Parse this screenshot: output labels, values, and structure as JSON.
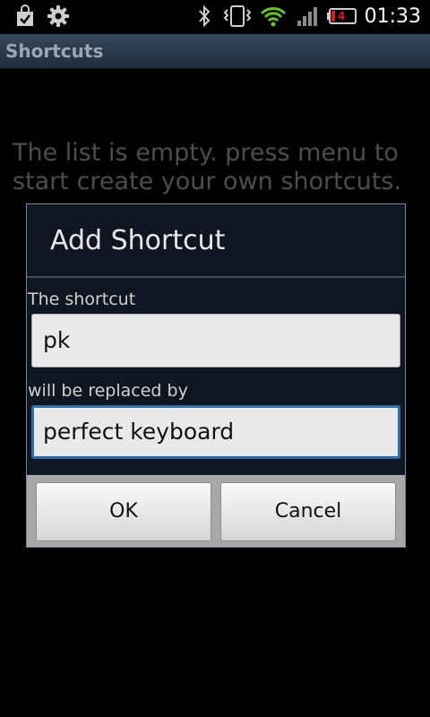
{
  "status_bar": {
    "time": "01:33",
    "battery_level": "4",
    "icons": [
      "bag-icon",
      "gear-icon",
      "bluetooth-icon",
      "vibrate-icon",
      "wifi-icon",
      "signal-icon",
      "battery-icon"
    ]
  },
  "app": {
    "title": "Shortcuts"
  },
  "main": {
    "empty_message": "The list is empty. press menu to start create your own shortcuts."
  },
  "dialog": {
    "title": "Add Shortcut",
    "shortcut_label": "The shortcut",
    "shortcut_value": "pk",
    "replacement_label": "will be replaced by",
    "replacement_value": "perfect keyboard",
    "ok_label": "OK",
    "cancel_label": "Cancel"
  },
  "colors": {
    "accent": "#2d6fa8",
    "battery_warning": "#d61d1d",
    "wifi": "#6cbf2f"
  }
}
